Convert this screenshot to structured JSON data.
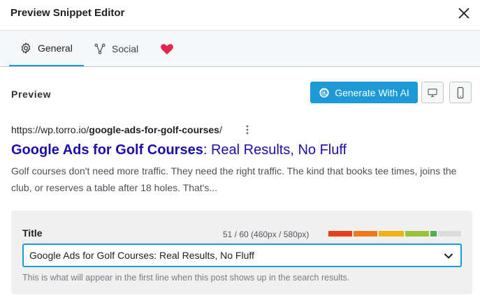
{
  "dialog": {
    "title": "Preview Snippet Editor"
  },
  "tabs": [
    {
      "label": "General",
      "icon": "gear-icon",
      "active": true
    },
    {
      "label": "Social",
      "icon": "share-nodes-icon",
      "active": false
    },
    {
      "label": "",
      "icon": "heart-icon",
      "active": false
    }
  ],
  "preview": {
    "label": "Preview",
    "generate_label": "Generate With AI",
    "devices": [
      "desktop-icon",
      "mobile-icon"
    ]
  },
  "serp": {
    "url_base": "https://wp.torro.io/",
    "url_slug": "google-ads-for-golf-courses",
    "url_end": "/",
    "title_bold": "Google Ads for Golf Courses",
    "title_rest": ": Real Results, No Fluff",
    "description": "Golf courses don't need more traffic. They need the right traffic. The kind that books tee times, joins the club, or reserves a table after 18 holes. That's..."
  },
  "title_field": {
    "label": "Title",
    "counter": "51 / 60 (460px / 580px)",
    "fill_fraction": 0.79,
    "value": "Google Ads for Golf Courses: Real Results, No Fluff",
    "help": "This is what will appear in the first line when this post shows up in the search results."
  },
  "colors": {
    "accent": "#1d9ad6",
    "link": "#1a0dab",
    "heart": "#e2264d",
    "meter": [
      "#e2401c",
      "#ec7a1c",
      "#f0b00f",
      "#9bc23a",
      "#4caf50",
      "#dcdcde"
    ]
  }
}
